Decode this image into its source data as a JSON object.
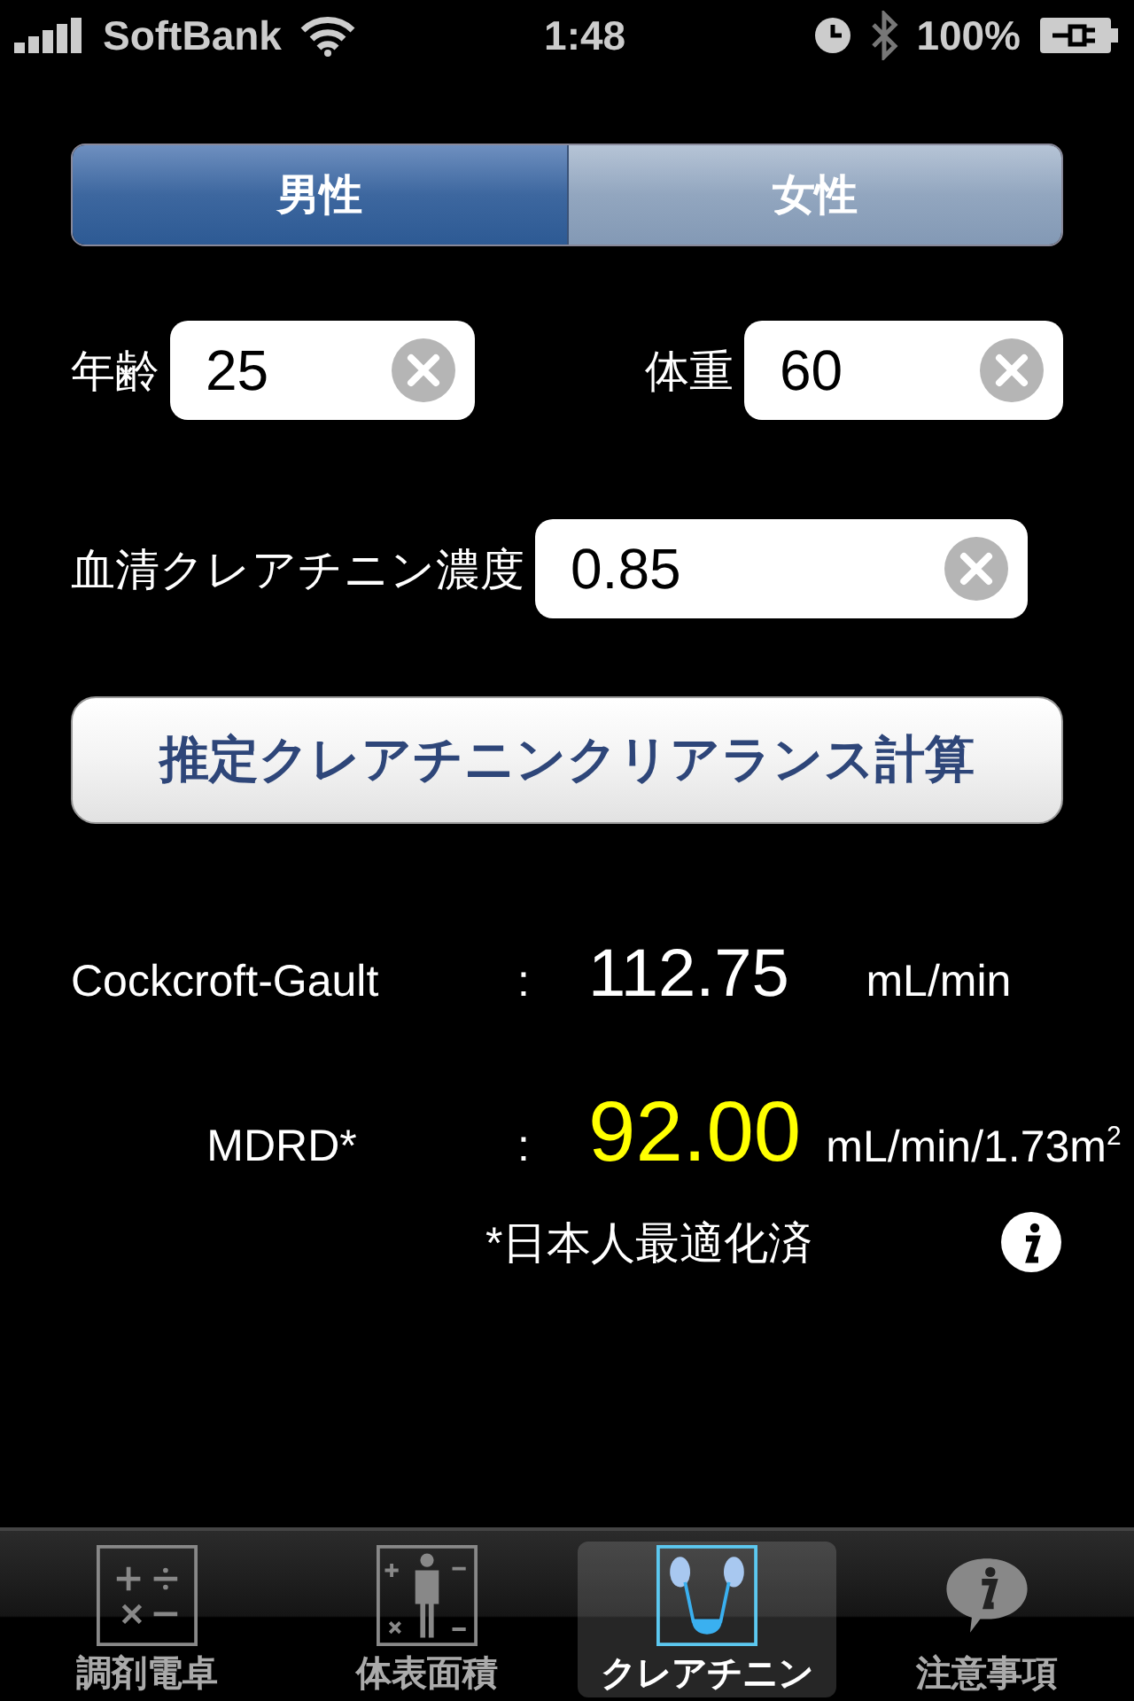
{
  "status_bar": {
    "carrier": "SoftBank",
    "time": "1:48",
    "battery": "100%"
  },
  "segments": [
    {
      "label": "男性",
      "selected": true
    },
    {
      "label": "女性",
      "selected": false
    }
  ],
  "field_rows": [
    [
      {
        "label": "年齢",
        "value": "25"
      },
      {
        "label": "体重",
        "value": "60"
      }
    ],
    [
      {
        "label": "血清クレアチニン濃度",
        "value": "0.85"
      }
    ]
  ],
  "calculate_button": "推定クレアチニンクリアランス計算",
  "results": [
    {
      "name": "Cockcroft-Gault",
      "separator": ":",
      "value": "112.75",
      "unit": "mL/min",
      "highlighted": false
    },
    {
      "name": "MDRD*",
      "separator": ":",
      "value": "92.00",
      "unit": "mL/min/1.73m$^{2}$",
      "highlighted": true
    }
  ],
  "note": "*日本人最適化済",
  "tabs": [
    {
      "label": "調剤電卓",
      "kind": "calculator",
      "selected": false
    },
    {
      "label": "体表面積",
      "kind": "body",
      "selected": false
    },
    {
      "label": "クレアチニン",
      "kind": "kidney",
      "selected": true
    },
    {
      "label": "注意事項",
      "kind": "info",
      "selected": false
    }
  ]
}
